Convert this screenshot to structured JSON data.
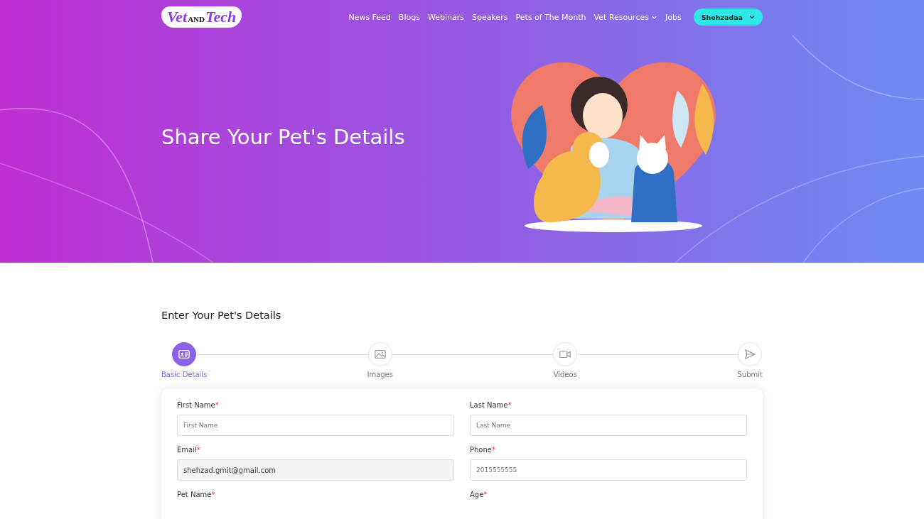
{
  "header": {
    "logo": {
      "part_1": "Vet",
      "part_2": "AND",
      "part_3": "Tech"
    },
    "nav": [
      {
        "label": "News Feed",
        "has_dropdown": false
      },
      {
        "label": "Blogs",
        "has_dropdown": false
      },
      {
        "label": "Webinars",
        "has_dropdown": false
      },
      {
        "label": "Speakers",
        "has_dropdown": false
      },
      {
        "label": "Pets of The Month",
        "has_dropdown": false
      },
      {
        "label": "Vet Resources",
        "has_dropdown": true
      },
      {
        "label": "Jobs",
        "has_dropdown": false
      }
    ],
    "user_button": "Shehzadaa"
  },
  "hero": {
    "title": "Share Your Pet's Details"
  },
  "form": {
    "title": "Enter Your Pet's Details",
    "steps": [
      {
        "label": "Basic Details",
        "kind": "id-card",
        "selected": true
      },
      {
        "label": "Images",
        "kind": "image",
        "selected": false
      },
      {
        "label": "Videos",
        "kind": "video",
        "selected": false
      },
      {
        "label": "Submit",
        "kind": "send",
        "selected": false
      }
    ],
    "fields": [
      {
        "label": "First Name",
        "required_mark": "*",
        "placeholder": "First Name",
        "disabled": false
      },
      {
        "label": "Last Name",
        "required_mark": "*",
        "placeholder": "Last Name",
        "disabled": false
      },
      {
        "label": "Email",
        "required_mark": "*",
        "value": "shehzad.gmit@gmail.com",
        "disabled": true
      },
      {
        "label": "Phone",
        "required_mark": "*",
        "placeholder": "2015555555",
        "disabled": false
      },
      {
        "label": "Pet Name",
        "required_mark": "*"
      },
      {
        "label": "Age",
        "required_mark": "*"
      }
    ]
  }
}
